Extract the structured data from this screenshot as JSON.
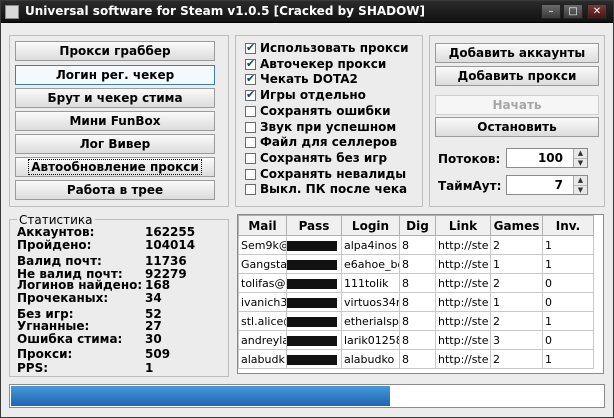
{
  "window": {
    "title": "Universal software for Steam v1.0.5   [Cracked by SHADOW]"
  },
  "left_buttons": [
    {
      "label": "Прокси граббер",
      "state": "normal"
    },
    {
      "label": "Логин рег. чекер",
      "state": "active"
    },
    {
      "label": "Брут и чекер стима",
      "state": "normal"
    },
    {
      "label": "Мини FunBox",
      "state": "normal"
    },
    {
      "label": "Лог Вивер",
      "state": "normal"
    },
    {
      "label": "Автообновление прокси",
      "state": "focused"
    },
    {
      "label": "Работа в трее",
      "state": "normal"
    }
  ],
  "options": [
    {
      "label": "Использовать прокси",
      "checked": true
    },
    {
      "label": "Авточекер прокси",
      "checked": true
    },
    {
      "label": "Чекать DOTA2",
      "checked": true
    },
    {
      "label": "Игры отдельно",
      "checked": true
    },
    {
      "label": "Сохранять ошибки",
      "checked": false
    },
    {
      "label": "Звук при успешном",
      "checked": false
    },
    {
      "label": "Файл для селлеров",
      "checked": false
    },
    {
      "label": "Сохранять без игр",
      "checked": false
    },
    {
      "label": "Сохранять невалиды",
      "checked": false
    },
    {
      "label": "Выкл. ПК после чека",
      "checked": false
    }
  ],
  "actions": {
    "add_accounts": "Добавить аккаунты",
    "add_proxies": "Добавить прокси",
    "start": "Начать",
    "stop": "Остановить"
  },
  "settings": {
    "threads_label": "Потоков:",
    "threads_value": "100",
    "timeout_label": "ТаймАут:",
    "timeout_value": "7"
  },
  "stats": {
    "title": "Статистика",
    "rows": [
      {
        "label": "Аккаунтов:",
        "value": "162255"
      },
      {
        "label": "Пройдено:",
        "value": "104014"
      },
      {
        "label": "Валид почт:",
        "value": "11736"
      },
      {
        "label": "Не валид почт:",
        "value": "92279"
      },
      {
        "label": "Логинов найдено:",
        "value": "168"
      },
      {
        "label": "Прочеканых:",
        "value": "34"
      },
      {
        "label": "Без игр:",
        "value": "52"
      },
      {
        "label": "Угнанные:",
        "value": "27"
      },
      {
        "label": "Ошибка стима:",
        "value": "30"
      },
      {
        "label": "Прокси:",
        "value": "509"
      },
      {
        "label": "PPS:",
        "value": "1"
      }
    ]
  },
  "results_table": {
    "columns": [
      "Mail",
      "Pass",
      "Login",
      "Dig",
      "Link",
      "Games",
      "Inv."
    ],
    "rows": [
      [
        "Sem9k@",
        "",
        "alpa4inos",
        "8",
        "http://ste",
        "2",
        "1"
      ],
      [
        "Gangsta",
        "",
        "e6ahoe_bo",
        "8",
        "http://ste",
        "1",
        "1"
      ],
      [
        "tolifas@",
        "",
        "111tolik",
        "8",
        "http://ste",
        "2",
        "0"
      ],
      [
        "ivanich3",
        "",
        "virtuos34r",
        "8",
        "http://ste",
        "1",
        "0"
      ],
      [
        "stl.alice@",
        "",
        "etherialspi",
        "8",
        "http://ste",
        "2",
        "1"
      ],
      [
        "andreyla",
        "",
        "larik01258",
        "8",
        "http://ste",
        "3",
        "0"
      ],
      [
        "alabudk",
        "",
        "alabudko",
        "8",
        "http://ste",
        "2",
        "1"
      ]
    ]
  },
  "progress": {
    "fraction": 0.64
  }
}
